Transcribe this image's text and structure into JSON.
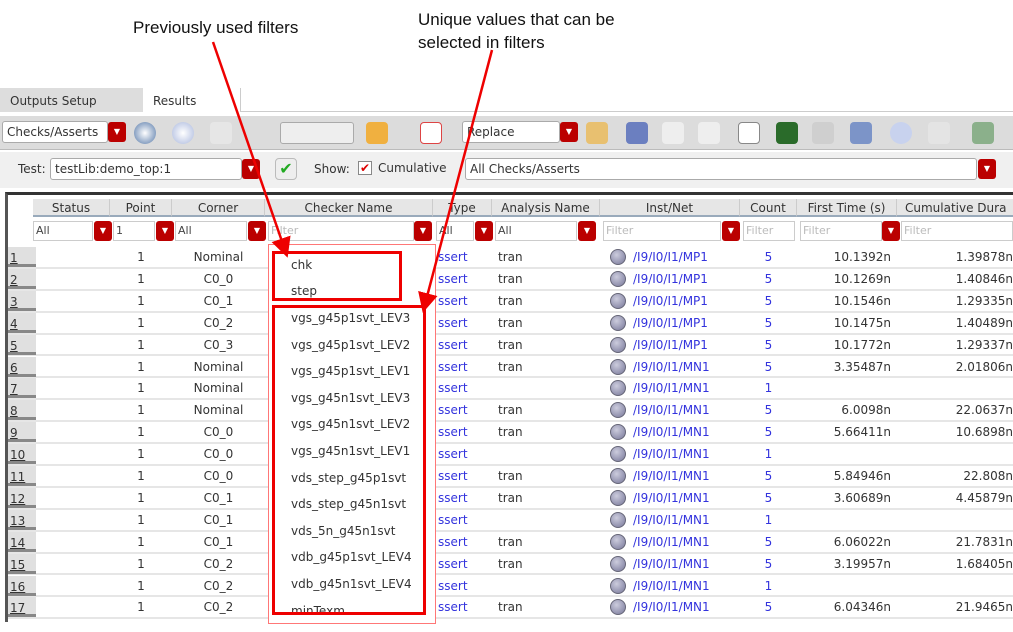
{
  "annotations": {
    "previous": "Previously used filters",
    "unique_line1": "Unique values that can be",
    "unique_line2": "selected in filters"
  },
  "tabs": [
    {
      "label": "Outputs Setup",
      "active": false
    },
    {
      "label": "Results",
      "active": true
    }
  ],
  "toolbar": {
    "view_select": "Checks/Asserts",
    "plot_mode": "Replace"
  },
  "testbar": {
    "test_label": "Test:",
    "test_value": "testLib:demo_top:1",
    "show_label": "Show:",
    "cumulative_label": "Cumulative",
    "cumulative_checked": true,
    "filter_select": "All Checks/Asserts"
  },
  "columns": [
    "Status",
    "Point",
    "Corner",
    "Checker Name",
    "Type",
    "Analysis Name",
    "Inst/Net",
    "Count",
    "First Time (s)",
    "Cumulative Dura"
  ],
  "filters": {
    "status": "All",
    "point": "1",
    "corner": "All",
    "checker": "Filter",
    "type": "All",
    "analysis": "All",
    "inst": "Filter",
    "count": "Filter",
    "first": "Filter",
    "cumulative": "Filter"
  },
  "rows": [
    {
      "n": "1",
      "point": "1",
      "corner": "Nominal",
      "type": "ssert",
      "analysis": "tran",
      "inst": "/I9/I0/I1/MP1",
      "count": "5",
      "first": "10.1392n",
      "cum": "1.39878n"
    },
    {
      "n": "2",
      "point": "1",
      "corner": "C0_0",
      "type": "ssert",
      "analysis": "tran",
      "inst": "/I9/I0/I1/MP1",
      "count": "5",
      "first": "10.1269n",
      "cum": "1.40846n"
    },
    {
      "n": "3",
      "point": "1",
      "corner": "C0_1",
      "type": "ssert",
      "analysis": "tran",
      "inst": "/I9/I0/I1/MP1",
      "count": "5",
      "first": "10.1546n",
      "cum": "1.29335n"
    },
    {
      "n": "4",
      "point": "1",
      "corner": "C0_2",
      "type": "ssert",
      "analysis": "tran",
      "inst": "/I9/I0/I1/MP1",
      "count": "5",
      "first": "10.1475n",
      "cum": "1.40489n"
    },
    {
      "n": "5",
      "point": "1",
      "corner": "C0_3",
      "type": "ssert",
      "analysis": "tran",
      "inst": "/I9/I0/I1/MP1",
      "count": "5",
      "first": "10.1772n",
      "cum": "1.29337n"
    },
    {
      "n": "6",
      "point": "1",
      "corner": "Nominal",
      "type": "ssert",
      "analysis": "tran",
      "inst": "/I9/I0/I1/MN1",
      "count": "5",
      "first": "3.35487n",
      "cum": "2.01806n"
    },
    {
      "n": "7",
      "point": "1",
      "corner": "Nominal",
      "type": "ssert",
      "analysis": "",
      "inst": "/I9/I0/I1/MN1",
      "count": "1",
      "first": "",
      "cum": ""
    },
    {
      "n": "8",
      "point": "1",
      "corner": "Nominal",
      "type": "ssert",
      "analysis": "tran",
      "inst": "/I9/I0/I1/MN1",
      "count": "5",
      "first": "6.0098n",
      "cum": "22.0637n"
    },
    {
      "n": "9",
      "point": "1",
      "corner": "C0_0",
      "type": "ssert",
      "analysis": "tran",
      "inst": "/I9/I0/I1/MN1",
      "count": "5",
      "first": "5.66411n",
      "cum": "10.6898n"
    },
    {
      "n": "10",
      "point": "1",
      "corner": "C0_0",
      "type": "ssert",
      "analysis": "",
      "inst": "/I9/I0/I1/MN1",
      "count": "1",
      "first": "",
      "cum": ""
    },
    {
      "n": "11",
      "point": "1",
      "corner": "C0_0",
      "type": "ssert",
      "analysis": "tran",
      "inst": "/I9/I0/I1/MN1",
      "count": "5",
      "first": "5.84946n",
      "cum": "22.808n"
    },
    {
      "n": "12",
      "point": "1",
      "corner": "C0_1",
      "type": "ssert",
      "analysis": "tran",
      "inst": "/I9/I0/I1/MN1",
      "count": "5",
      "first": "3.60689n",
      "cum": "4.45879n"
    },
    {
      "n": "13",
      "point": "1",
      "corner": "C0_1",
      "type": "ssert",
      "analysis": "",
      "inst": "/I9/I0/I1/MN1",
      "count": "1",
      "first": "",
      "cum": ""
    },
    {
      "n": "14",
      "point": "1",
      "corner": "C0_1",
      "type": "ssert",
      "analysis": "tran",
      "inst": "/I9/I0/I1/MN1",
      "count": "5",
      "first": "6.06022n",
      "cum": "21.7831n"
    },
    {
      "n": "15",
      "point": "1",
      "corner": "C0_2",
      "type": "ssert",
      "analysis": "tran",
      "inst": "/I9/I0/I1/MN1",
      "count": "5",
      "first": "3.19957n",
      "cum": "1.68405n"
    },
    {
      "n": "16",
      "point": "1",
      "corner": "C0_2",
      "type": "ssert",
      "analysis": "",
      "inst": "/I9/I0/I1/MN1",
      "count": "1",
      "first": "",
      "cum": ""
    },
    {
      "n": "17",
      "point": "1",
      "corner": "C0_2",
      "type": "ssert",
      "analysis": "tran",
      "inst": "/I9/I0/I1/MN1",
      "count": "5",
      "first": "6.04346n",
      "cum": "21.9465n"
    }
  ],
  "popup": {
    "previous": [
      "chk",
      "step"
    ],
    "values": [
      "vgs_g45p1svt_LEV3",
      "vgs_g45p1svt_LEV2",
      "vgs_g45p1svt_LEV1",
      "vgs_g45n1svt_LEV3",
      "vgs_g45n1svt_LEV2",
      "vgs_g45n1svt_LEV1",
      "vds_step_g45p1svt",
      "vds_step_g45n1svt",
      "vds_5n_g45n1svt",
      "vdb_g45p1svt_LEV4",
      "vdb_g45n1svt_LEV4",
      "minTexm"
    ]
  },
  "colors": {
    "accent_red": "#b00000",
    "annotation_red": "#ee0000",
    "link_blue": "#3333dd"
  }
}
